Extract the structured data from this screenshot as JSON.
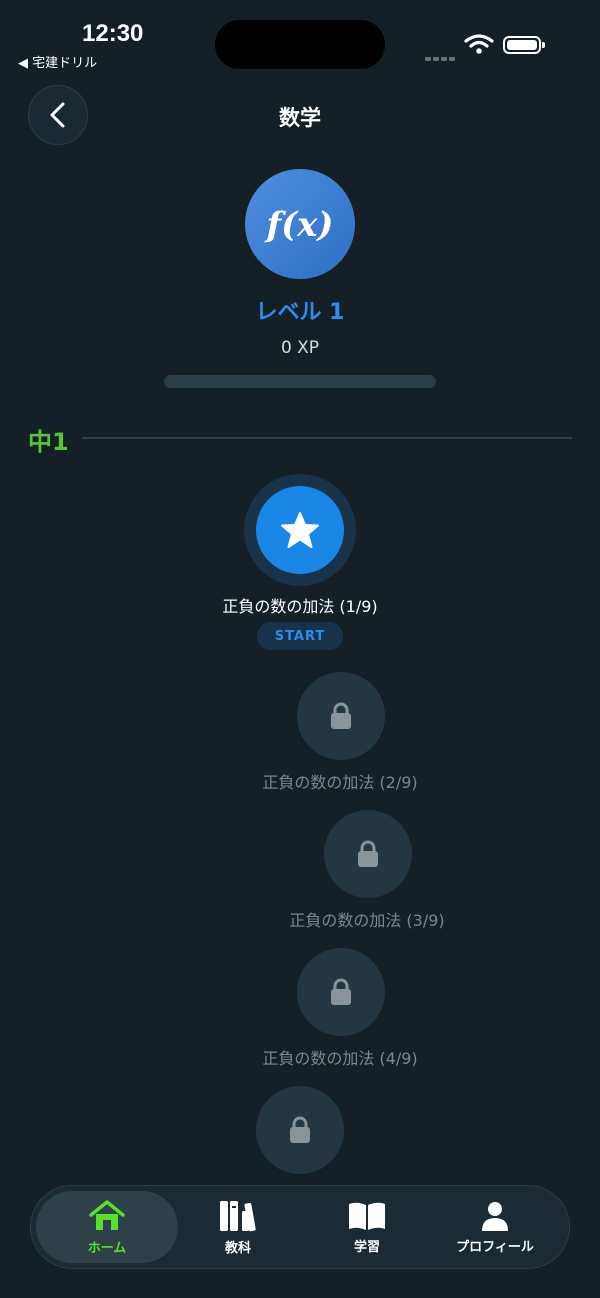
{
  "status_bar": {
    "time": "12:30",
    "back_app": "◀ 宅建ドリル"
  },
  "header": {
    "title": "数学",
    "back_icon": "chevron-left-icon"
  },
  "subject": {
    "icon": "function-fx-icon",
    "icon_text": "f(x)",
    "level": "レベル 1",
    "xp": "0 XP",
    "xp_progress": 0
  },
  "section": {
    "label": "中1",
    "color": "#58c43a"
  },
  "lessons": [
    {
      "title": "正負の数の加法 (1/9)",
      "state": "active",
      "action": "START",
      "icon": "star-icon"
    },
    {
      "title": "正負の数の加法 (2/9)",
      "state": "locked",
      "icon": "lock-icon"
    },
    {
      "title": "正負の数の加法 (3/9)",
      "state": "locked",
      "icon": "lock-icon"
    },
    {
      "title": "正負の数の加法 (4/9)",
      "state": "locked",
      "icon": "lock-icon"
    },
    {
      "title": "",
      "state": "locked",
      "icon": "lock-icon"
    }
  ],
  "nav": {
    "items": [
      {
        "label": "ホーム",
        "icon": "home-icon",
        "active": true
      },
      {
        "label": "教科",
        "icon": "books-icon",
        "active": false
      },
      {
        "label": "学習",
        "icon": "open-book-icon",
        "active": false
      },
      {
        "label": "プロフィール",
        "icon": "person-icon",
        "active": false
      }
    ]
  },
  "colors": {
    "accent": "#2c8df0",
    "active_nav": "#58e02c",
    "background": "#152026"
  }
}
